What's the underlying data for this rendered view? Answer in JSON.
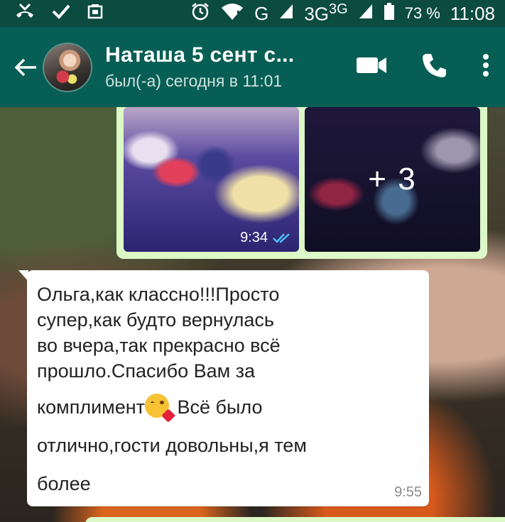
{
  "status_bar": {
    "battery": "73 %",
    "time": "11:08",
    "network_g": "G",
    "network_3g": "3G",
    "network_3g_sup": "3G"
  },
  "header": {
    "contact_name": "Наташа 5 сент с...",
    "last_seen": "был(-а) сегодня в 11:01"
  },
  "media_message": {
    "more_count": "+ 3",
    "time": "9:34"
  },
  "text_message": {
    "lines": [
      "Ольга,как классно!!!Просто",
      "супер,как будто вернулась",
      "во вчера,так прекрасно всё",
      "прошло.Спасибо Вам за",
      "комплимент",
      "Всё было",
      "отлично,гости довольны,я тем",
      "более"
    ],
    "time": "9:55"
  },
  "colors": {
    "status_bar": "#0b4b40",
    "header": "#075e54",
    "outgoing_bubble": "#dcf8c6",
    "incoming_bubble": "#ffffff",
    "read_ticks": "#4fc3f7"
  }
}
